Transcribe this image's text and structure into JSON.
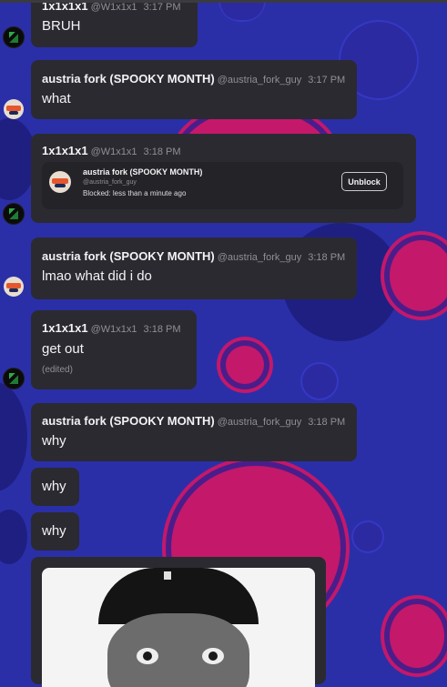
{
  "messages": [
    {
      "name": "1x1x1x1",
      "handle": "@W1x1x1",
      "time": "3:17 PM",
      "text": "BRUH"
    },
    {
      "name": "austria fork (SPOOKY MONTH)",
      "handle": "@austria_fork_guy",
      "time": "3:17 PM",
      "text": "what"
    },
    {
      "name": "1x1x1x1",
      "handle": "@W1x1x1",
      "time": "3:18 PM",
      "card": {
        "name": "austria fork (SPOOKY MONTH)",
        "handle": "@austria_fork_guy",
        "status": "Blocked: less than a minute ago",
        "button": "Unblock"
      }
    },
    {
      "name": "austria fork (SPOOKY MONTH)",
      "handle": "@austria_fork_guy",
      "time": "3:18 PM",
      "text": "lmao what did i do"
    },
    {
      "name": "1x1x1x1",
      "handle": "@W1x1x1",
      "time": "3:18 PM",
      "text": "get out",
      "edited": "(edited)"
    },
    {
      "name": "austria fork (SPOOKY MONTH)",
      "handle": "@austria_fork_guy",
      "time": "3:18 PM",
      "text": "why"
    },
    {
      "text": "why"
    },
    {
      "text": "why"
    }
  ],
  "icons": {
    "avatar_1x1x1x1": "green-slash-avatar-icon",
    "avatar_austria_fork": "orange-helmet-avatar-icon"
  },
  "colors": {
    "background": "#2a2fa8",
    "bubble": "#2b2a30",
    "card": "#232328",
    "pink_circle": "#c4186b",
    "muted_text": "#8e9097"
  }
}
